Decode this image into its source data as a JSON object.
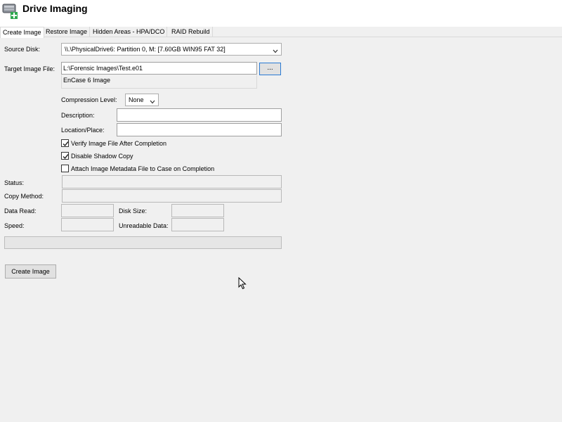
{
  "app": {
    "title": "Drive Imaging"
  },
  "tabs": [
    {
      "label": "Create Image"
    },
    {
      "label": "Restore Image"
    },
    {
      "label": "Hidden Areas - HPA/DCO"
    },
    {
      "label": "RAID Rebuild"
    }
  ],
  "form": {
    "source_disk_label": "Source Disk:",
    "source_disk_value": "\\\\.\\PhysicalDrive6: Partition 0, M: [7.60GB WIN95 FAT 32]",
    "target_file_label": "Target Image File:",
    "target_file_value": "L:\\Forensic Images\\Test.e01",
    "browse_label": "...",
    "image_format_value": "EnCase 6 Image",
    "compression_label": "Compression Level:",
    "compression_value": "None",
    "description_label": "Description:",
    "description_value": "",
    "location_label": "Location/Place:",
    "location_value": "",
    "verify_label": "Verify Image File After Completion",
    "verify_checked": true,
    "shadow_label": "Disable Shadow Copy",
    "shadow_checked": true,
    "attach_label": "Attach Image Metadata File to Case on Completion",
    "attach_checked": false
  },
  "status": {
    "status_label": "Status:",
    "status_value": "",
    "copy_method_label": "Copy Method:",
    "copy_method_value": "",
    "data_read_label": "Data Read:",
    "data_read_value": "",
    "disk_size_label": "Disk Size:",
    "disk_size_value": "",
    "speed_label": "Speed:",
    "speed_value": "",
    "unreadable_label": "Unreadable Data:",
    "unreadable_value": "",
    "progress_fraction": 0
  },
  "actions": {
    "create_image_label": "Create Image"
  },
  "icons": {
    "app_icon": "drive-imaging-icon",
    "dropdown": "chevron-down-icon",
    "check": "checkmark-icon",
    "cursor": "mouse-pointer-icon"
  },
  "colors": {
    "background": "#f0f0f0",
    "accent": "#2a7ad3",
    "plus_green": "#2fa84f"
  }
}
